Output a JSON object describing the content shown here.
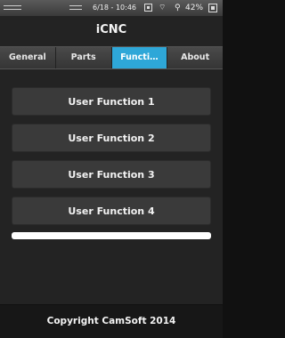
{
  "status_bar": {
    "time": "6/18 - 10:46",
    "battery": "42%",
    "icons": [
      "menu-icon",
      "menu-icon",
      "screenshot-icon",
      "wifi-icon",
      "location-icon",
      "battery-icon"
    ]
  },
  "app": {
    "title": "iCNC"
  },
  "tabs": [
    {
      "label": "General",
      "active": false
    },
    {
      "label": "Parts",
      "active": false
    },
    {
      "label": "Functi…",
      "active": true
    },
    {
      "label": "About",
      "active": false
    }
  ],
  "functions": [
    {
      "label": "User Function 1"
    },
    {
      "label": "User Function 2"
    },
    {
      "label": "User Function 3"
    },
    {
      "label": "User Function 4"
    }
  ],
  "input": {
    "value": ""
  },
  "footer": {
    "text": "Copyright CamSoft 2014"
  },
  "colors": {
    "accent": "#2ea7d8",
    "background": "#232323",
    "button": "#3a3a3a"
  }
}
